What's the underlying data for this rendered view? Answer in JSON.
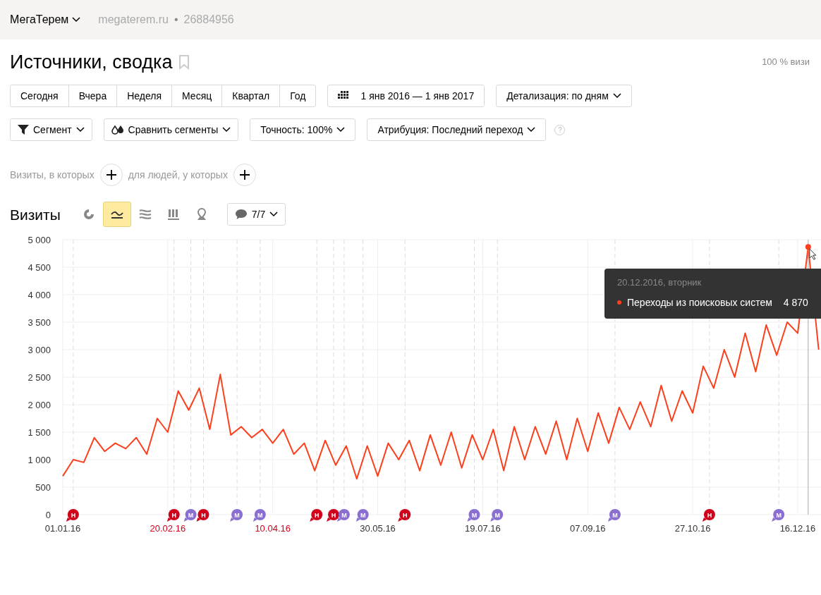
{
  "header": {
    "counter_name": "МегаТерем",
    "site": "megaterem.ru",
    "separator": "•",
    "counter_id": "26884956"
  },
  "page": {
    "title": "Источники, сводка",
    "sample_note": "100 % визи"
  },
  "periods": [
    {
      "label": "Сегодня",
      "selected": false
    },
    {
      "label": "Вчера",
      "selected": false
    },
    {
      "label": "Неделя",
      "selected": false
    },
    {
      "label": "Месяц",
      "selected": false
    },
    {
      "label": "Квартал",
      "selected": false
    },
    {
      "label": "Год",
      "selected": false
    }
  ],
  "date_range": "1 янв 2016 — 1 янв 2017",
  "detail": "Детализация: по дням",
  "filters": [
    {
      "kind": "segment",
      "label": "Сегмент"
    },
    {
      "kind": "compare",
      "label": "Сравнить сегменты"
    },
    {
      "kind": "plain",
      "label": "Точность: 100%"
    },
    {
      "kind": "plain",
      "label": "Атрибуция: Последний переход"
    }
  ],
  "help": "?",
  "conditions": [
    {
      "label": "Визиты, в которых"
    },
    {
      "label": "для людей, у которых"
    }
  ],
  "chart_header": {
    "title": "Визиты",
    "comments": "7/7"
  },
  "chart_modes": [
    {
      "kind": "pie",
      "selected": false
    },
    {
      "kind": "line",
      "selected": true
    },
    {
      "kind": "area",
      "selected": false
    },
    {
      "kind": "bar",
      "selected": false
    },
    {
      "kind": "map",
      "selected": false
    }
  ],
  "chart": {
    "chart_data": {
      "type": "line",
      "categories": [
        "01.01.16",
        null,
        null,
        null,
        null,
        null,
        null,
        null,
        null,
        null,
        "20.02.16",
        null,
        null,
        null,
        null,
        null,
        null,
        null,
        null,
        null,
        "10.04.16",
        null,
        null,
        null,
        null,
        null,
        null,
        null,
        null,
        null,
        "30.05.16",
        null,
        null,
        null,
        null,
        null,
        null,
        null,
        null,
        null,
        "19.07.16",
        null,
        null,
        null,
        null,
        null,
        null,
        null,
        null,
        null,
        "07.09.16",
        null,
        null,
        null,
        null,
        null,
        null,
        null,
        null,
        null,
        "27.10.16",
        null,
        null,
        null,
        null,
        null,
        null,
        null,
        null,
        null,
        "16.12.16",
        null,
        null,
        null
      ],
      "series": [
        {
          "name": "Переходы из поисковых систем",
          "color": "#fc3f1d",
          "values": [
            700,
            1000,
            950,
            1400,
            1150,
            1300,
            1200,
            1400,
            1100,
            1750,
            1500,
            2250,
            1900,
            2300,
            1550,
            2550,
            1450,
            1600,
            1400,
            1550,
            1300,
            1550,
            1100,
            1300,
            800,
            1350,
            900,
            1250,
            650,
            1250,
            700,
            1300,
            1000,
            1350,
            800,
            1450,
            900,
            1500,
            850,
            1450,
            1000,
            1550,
            800,
            1600,
            1000,
            1600,
            1100,
            1700,
            1000,
            1750,
            1150,
            1850,
            1300,
            1950,
            1550,
            2050,
            1600,
            2350,
            1700,
            2250,
            1850,
            2700,
            2300,
            3000,
            2500,
            3300,
            2600,
            3450,
            2900,
            3500,
            3300,
            4870,
            3000,
            null
          ]
        }
      ],
      "ylim": [
        0,
        5000
      ],
      "grid": true,
      "yticks": [
        {
          "value": 0,
          "label": "0"
        },
        {
          "value": 500,
          "label": "500"
        },
        {
          "value": 1000,
          "label": "1 000"
        },
        {
          "value": 1500,
          "label": "1 500"
        },
        {
          "value": 2000,
          "label": "2 000"
        },
        {
          "value": 2500,
          "label": "2 500"
        },
        {
          "value": 3000,
          "label": "3 000"
        },
        {
          "value": 3500,
          "label": "3 500"
        },
        {
          "value": 4000,
          "label": "4 000"
        },
        {
          "value": 4500,
          "label": "4 500"
        },
        {
          "value": 5000,
          "label": "5 000"
        }
      ],
      "annotations": [
        {
          "text": "Н"
        },
        {
          "text": "Н"
        },
        {
          "text": "М"
        },
        {
          "text": "Н"
        },
        {
          "text": "М"
        },
        {
          "text": "М"
        },
        {
          "text": "Н"
        },
        {
          "text": "Н"
        },
        {
          "text": "М"
        },
        {
          "text": "М"
        },
        {
          "text": "Н"
        },
        {
          "text": "М"
        },
        {
          "text": "М"
        },
        {
          "text": "М"
        },
        {
          "text": "Н"
        },
        {
          "text": "М"
        }
      ]
    },
    "xtick_marks": [
      {
        "holiday": false
      },
      {
        "holiday": true
      },
      {
        "holiday": true
      },
      {
        "holiday": false
      },
      {
        "holiday": false
      },
      {
        "holiday": false
      },
      {
        "holiday": false
      },
      {
        "holiday": false
      }
    ],
    "marker_styles": [
      {
        "color": "#d0021b"
      },
      {
        "color": "#d0021b"
      },
      {
        "color": "#8a6fd1"
      },
      {
        "color": "#d0021b"
      },
      {
        "color": "#8a6fd1"
      },
      {
        "color": "#8a6fd1"
      },
      {
        "color": "#d0021b"
      },
      {
        "color": "#d0021b"
      },
      {
        "color": "#8a6fd1"
      },
      {
        "color": "#8a6fd1"
      },
      {
        "color": "#d0021b"
      },
      {
        "color": "#8a6fd1"
      },
      {
        "color": "#8a6fd1"
      },
      {
        "color": "#8a6fd1"
      },
      {
        "color": "#d0021b"
      },
      {
        "color": "#8a6fd1"
      }
    ],
    "tooltip": {
      "date": "20.12.2016, вторник",
      "value": "4 870"
    }
  }
}
